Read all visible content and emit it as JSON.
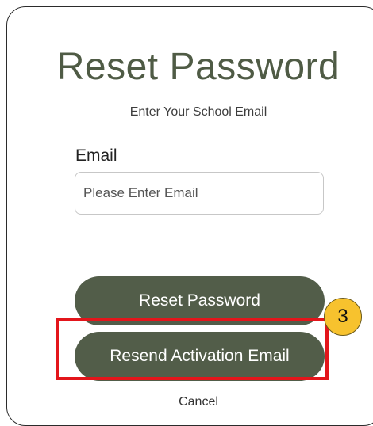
{
  "form": {
    "title": "Reset Password",
    "subtitle": "Enter Your School Email",
    "email_label": "Email",
    "email_placeholder": "Please Enter Email",
    "email_value": "",
    "reset_button_label": "Reset Password",
    "resend_button_label": "Resend Activation Email",
    "cancel_label": "Cancel"
  },
  "annotation": {
    "step_number": "3",
    "highlight_color": "#e3151b",
    "badge_color": "#f7c22e"
  },
  "colors": {
    "title": "#4f5b45",
    "button_bg": "#525d49"
  }
}
